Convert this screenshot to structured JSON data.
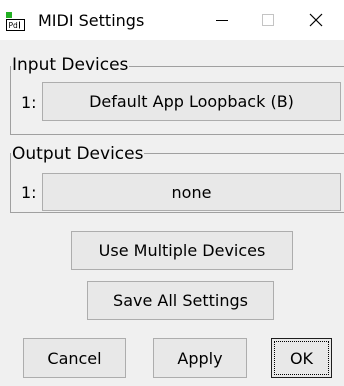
{
  "window": {
    "title": "MIDI Settings",
    "app_icon": "pd-icon"
  },
  "input_devices": {
    "label": "Input Devices",
    "devices": [
      {
        "number": "1:",
        "name": "Default App Loopback (B)"
      }
    ]
  },
  "output_devices": {
    "label": "Output Devices",
    "devices": [
      {
        "number": "1:",
        "name": "none"
      }
    ]
  },
  "buttons": {
    "multiple_devices": "Use Multiple Devices",
    "save_all": "Save All Settings",
    "cancel": "Cancel",
    "apply": "Apply",
    "ok": "OK"
  }
}
